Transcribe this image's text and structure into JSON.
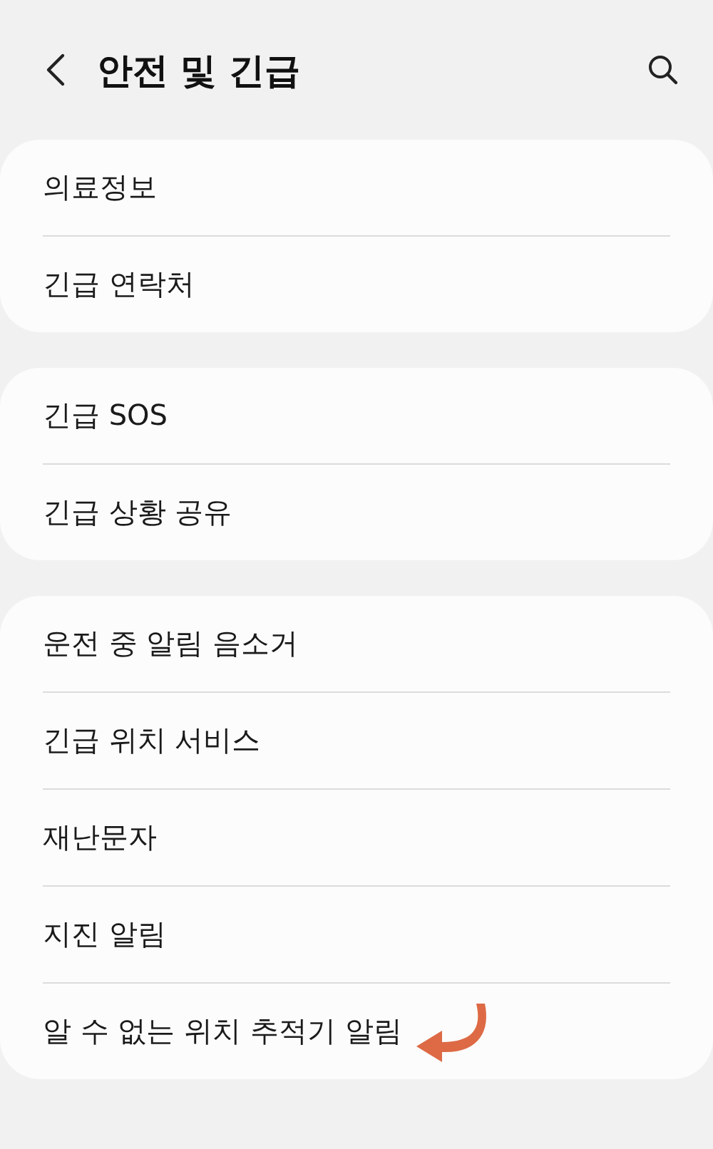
{
  "header": {
    "title": "안전 및 긴급"
  },
  "sections": [
    {
      "items": [
        {
          "label": "의료정보",
          "annotated": false
        },
        {
          "label": "긴급 연락처",
          "annotated": false
        }
      ]
    },
    {
      "items": [
        {
          "label": "긴급 SOS",
          "annotated": false
        },
        {
          "label": "긴급 상황 공유",
          "annotated": false
        }
      ]
    },
    {
      "items": [
        {
          "label": "운전 중 알림 음소거",
          "annotated": false
        },
        {
          "label": "긴급 위치 서비스",
          "annotated": false
        },
        {
          "label": "재난문자",
          "annotated": false
        },
        {
          "label": "지진 알림",
          "annotated": false
        },
        {
          "label": "알 수 없는 위치 추적기 알림",
          "annotated": true
        }
      ]
    }
  ]
}
